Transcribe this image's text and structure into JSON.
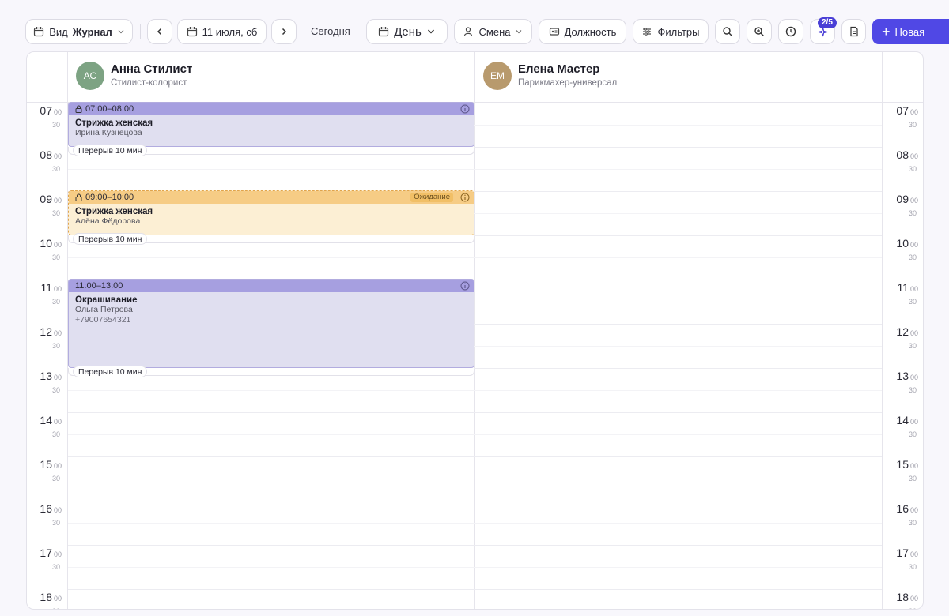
{
  "toolbar": {
    "view_label": "Вид",
    "view_value": "Журнал",
    "date_label": "11 июля, сб",
    "today_label": "Сегодня",
    "period_label": "День",
    "shift_label": "Смена",
    "position_label": "Должность",
    "filters_label": "Фильтры",
    "ai_badge": "2/5",
    "new_label": "Новая"
  },
  "staff": [
    {
      "initials": "АС",
      "name": "Анна Стилист",
      "role": "Стилист-колорист",
      "color": "#7da383"
    },
    {
      "initials": "ЕМ",
      "name": "Елена Мастер",
      "role": "Парикмахер-универсал",
      "color": "#b89a6d"
    }
  ],
  "hours": [
    "07",
    "08",
    "09",
    "10",
    "11",
    "12",
    "13",
    "14",
    "15",
    "16",
    "17",
    "18"
  ],
  "minutes_full": "00",
  "minutes_half": "30",
  "appointments": [
    {
      "time": "07:00–08:00",
      "title": "Стрижка женская",
      "client": "Ирина Кузнецова",
      "locked": true,
      "style": "purple"
    },
    {
      "time": "09:00–10:00",
      "title": "Стрижка женская",
      "client": "Алёна Фёдорова",
      "status": "Ожидание",
      "locked": true,
      "style": "orange"
    },
    {
      "time": "11:00–13:00",
      "title": "Окрашивание",
      "client": "Ольга Петрова",
      "phone": "+79007654321",
      "locked": false,
      "style": "purple"
    }
  ],
  "break_label": "Перерыв 10 мин"
}
